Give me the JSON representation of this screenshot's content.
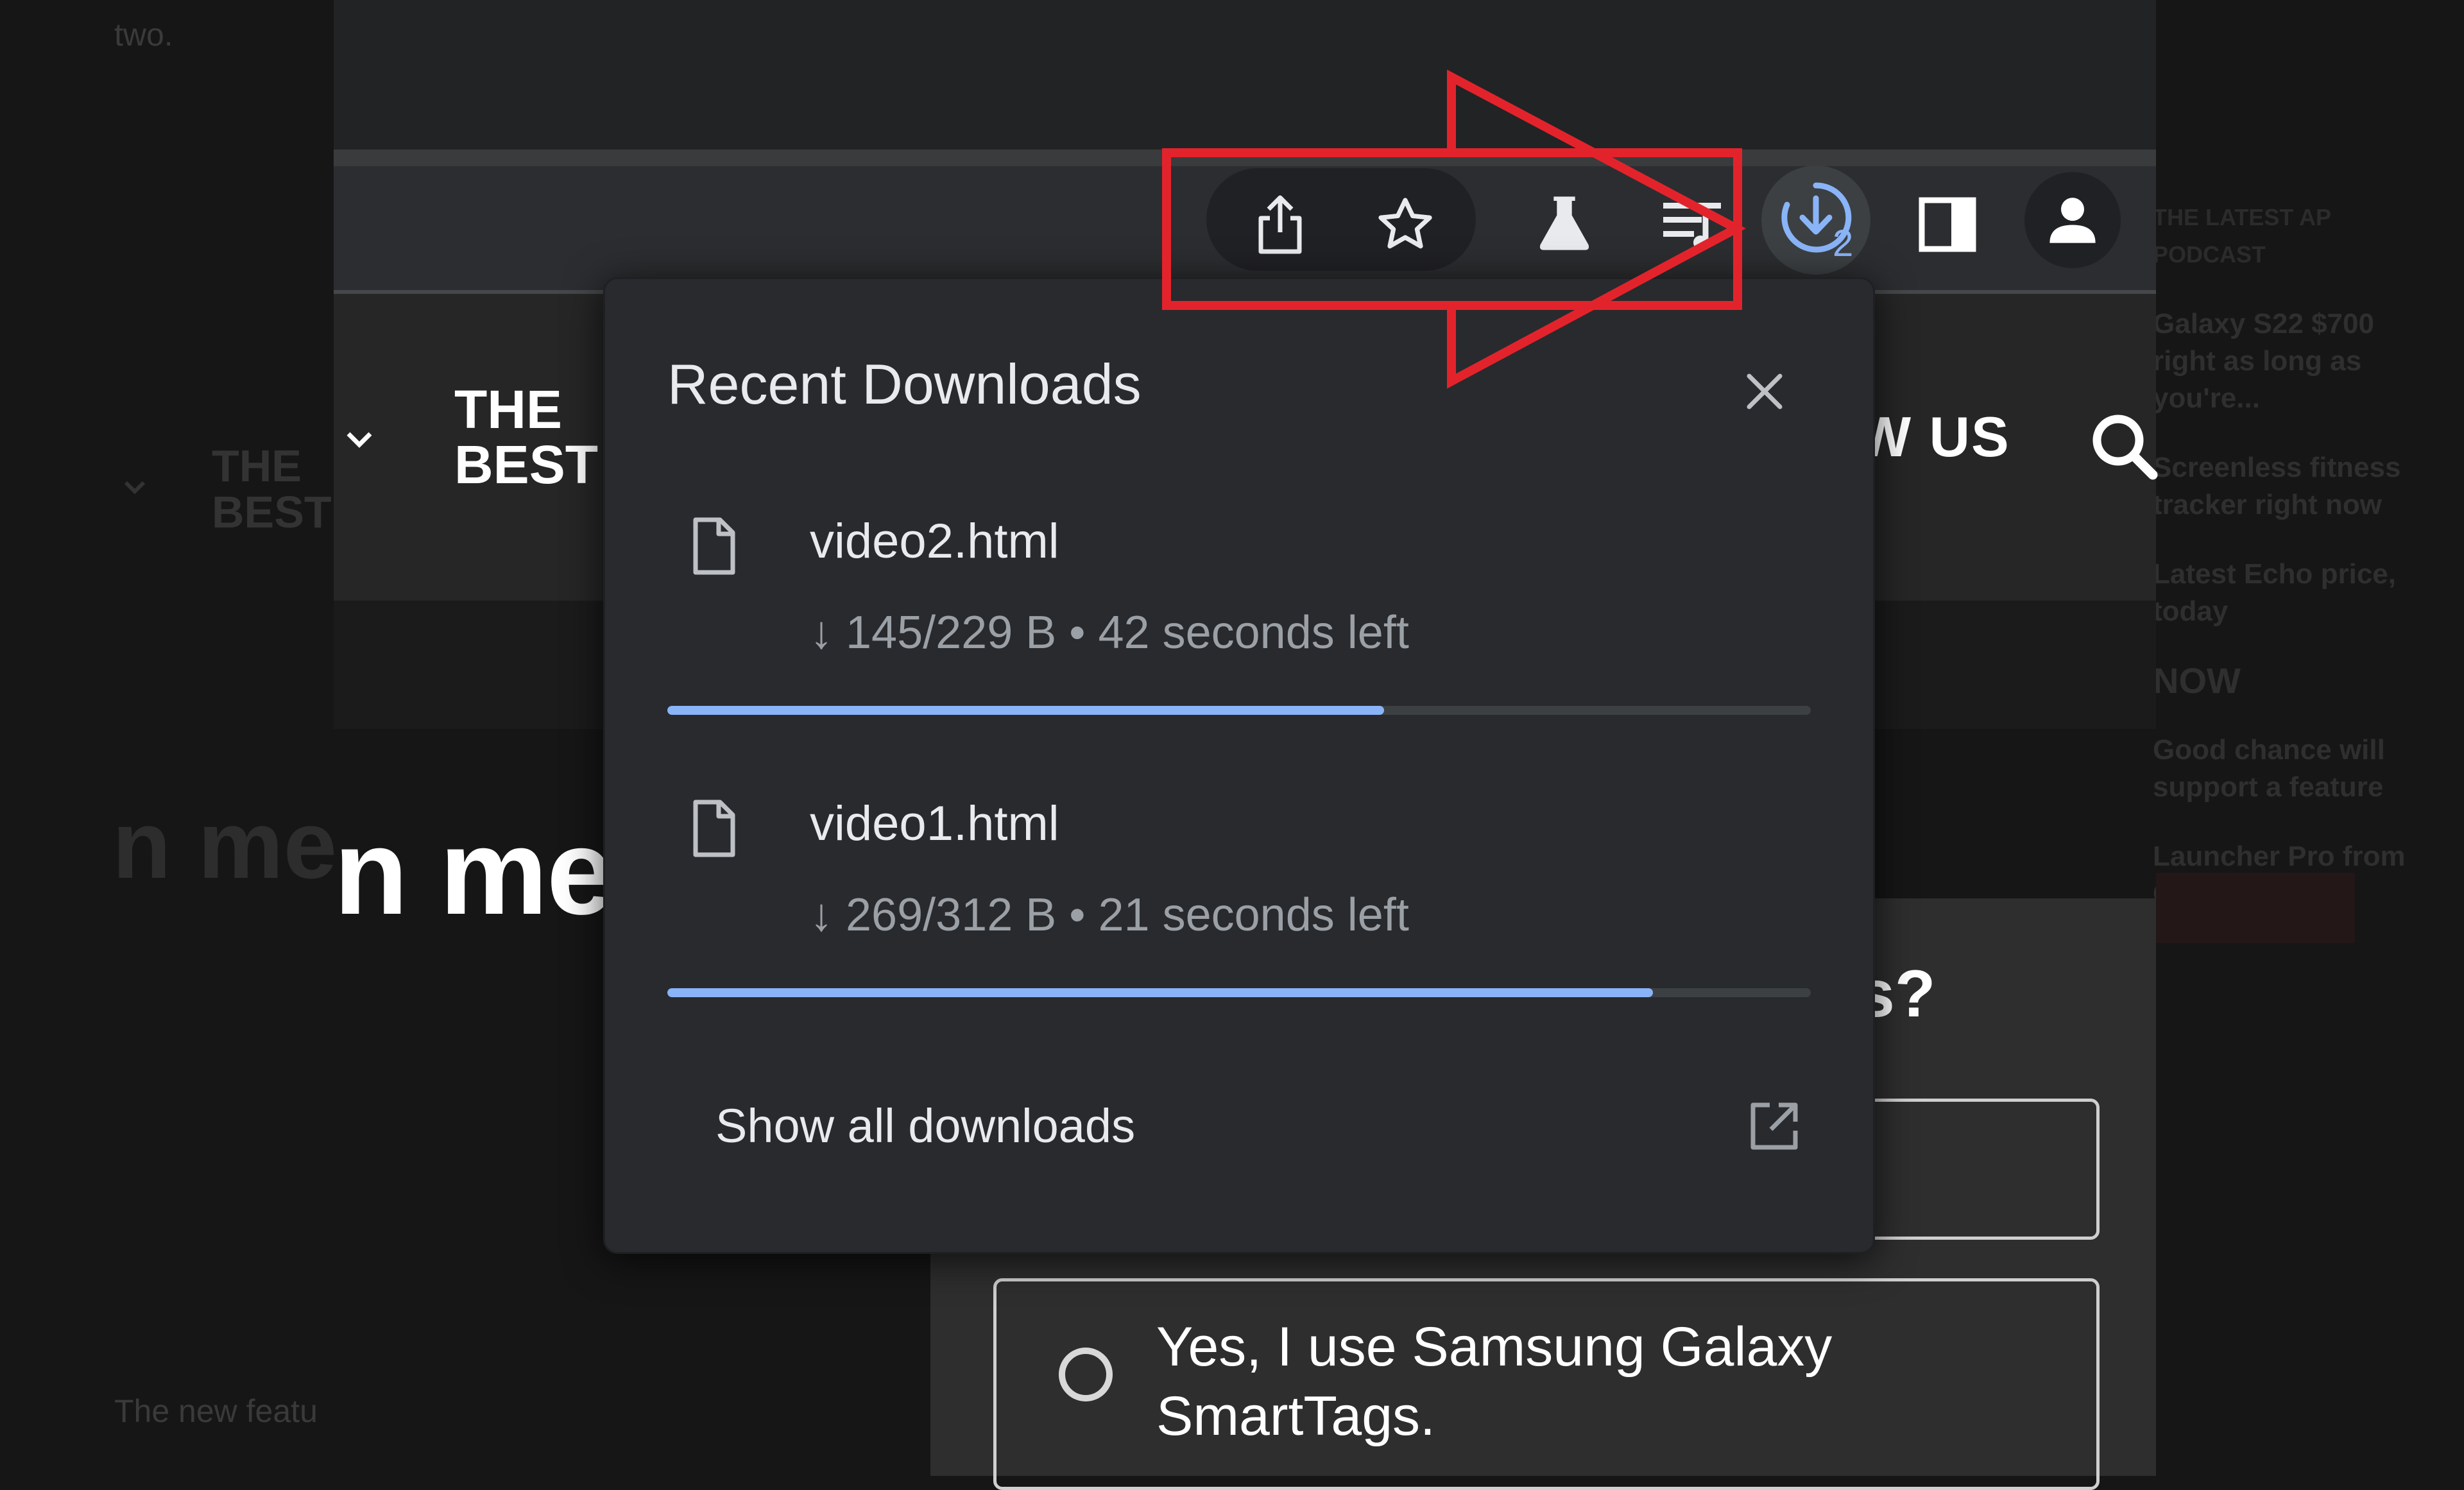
{
  "background": {
    "left_snippet_top": "two.",
    "left_snippet_bottom": "The new featu",
    "dim_brand": "THE\nBEST",
    "dim_headline": "n me",
    "right_column": [
      "THE LATEST AP PODCAST",
      "Galaxy S22 $700 right as long as you're...",
      "Screenless fitness tracker right now",
      "Latest Echo price, today",
      "NOW",
      "Good chance will support a feature",
      "Launcher Pro from Google"
    ]
  },
  "site": {
    "brand_line1": "THE",
    "brand_line2": "BEST",
    "nav_follow": "W US",
    "headline": "n mec",
    "poll_question_tail": "s?",
    "poll_option": "Yes, I use Samsung Galaxy SmartTags."
  },
  "toolbar": {
    "icons": [
      "share-icon",
      "bookmark-star-icon",
      "labs-flask-icon",
      "reading-list-icon",
      "downloads-icon",
      "side-panel-icon",
      "profile-icon"
    ],
    "download_badge": "2"
  },
  "downloads": {
    "title": "Recent Downloads",
    "items": [
      {
        "name": "video2.html",
        "status": "↓ 145/229 B • 42 seconds left",
        "progress": 0.627
      },
      {
        "name": "video1.html",
        "status": "↓ 269/312 B • 21 seconds left",
        "progress": 0.862
      }
    ],
    "show_all": "Show all downloads"
  },
  "colors": {
    "accent": "#8ab4f8",
    "annotation": "#e3232b",
    "bubble_bg": "#292a2d"
  }
}
